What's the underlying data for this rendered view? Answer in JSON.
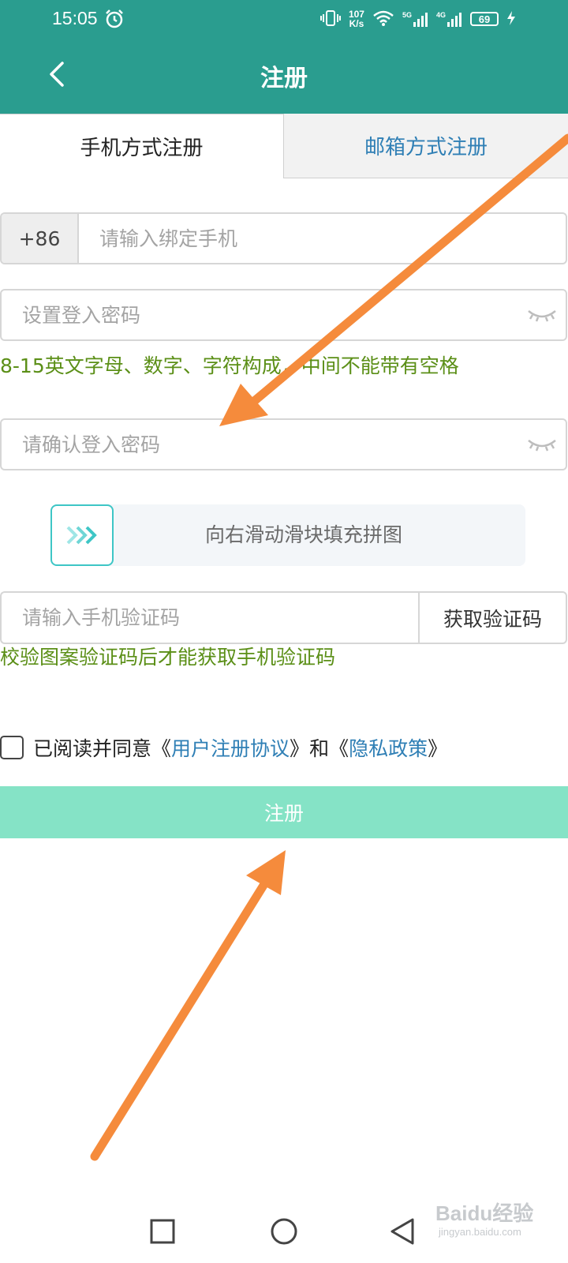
{
  "status_bar": {
    "time": "15:05",
    "net_speed_value": "107",
    "net_speed_unit": "K/s",
    "signal_1_label": "5G",
    "signal_2_label": "4G",
    "battery_level": "69",
    "icons": [
      "alarm-icon",
      "vibrate-icon",
      "wifi-icon",
      "signal-icon",
      "battery-icon",
      "charging-icon"
    ]
  },
  "header": {
    "title": "注册"
  },
  "tabs": [
    {
      "label": "手机方式注册",
      "active": true
    },
    {
      "label": "邮箱方式注册",
      "active": false
    }
  ],
  "form": {
    "phone": {
      "country_code": "+86",
      "placeholder": "请输入绑定手机"
    },
    "password": {
      "placeholder": "设置登入密码"
    },
    "password_hint": "8-15英文字母、数字、字符构成，中间不能带有空格",
    "confirm_password": {
      "placeholder": "请确认登入密码"
    },
    "slider": {
      "label": "向右滑动滑块填充拼图"
    },
    "sms_code": {
      "placeholder": "请输入手机验证码",
      "button_label": "获取验证码"
    },
    "sms_hint": "校验图案验证码后才能获取手机验证码",
    "agreement": {
      "prefix": "已阅读并同意",
      "open_quote_1": "《",
      "link1": "用户注册协议",
      "close_quote_1": "》",
      "middle": "和",
      "open_quote_2": "《",
      "link2": "隐私政策",
      "close_quote_2": "》"
    },
    "submit_label": "注册"
  },
  "watermark": {
    "main": "Baidu经验",
    "sub": "jingyan.baidu.com"
  },
  "colors": {
    "header_bg": "#2a9d8f",
    "hint_text": "#5b8f17",
    "link": "#2f7fb5",
    "submit_bg": "#85e3c6",
    "slider_accent": "#3ec6c6",
    "annotation_arrow": "#f58b3c"
  }
}
